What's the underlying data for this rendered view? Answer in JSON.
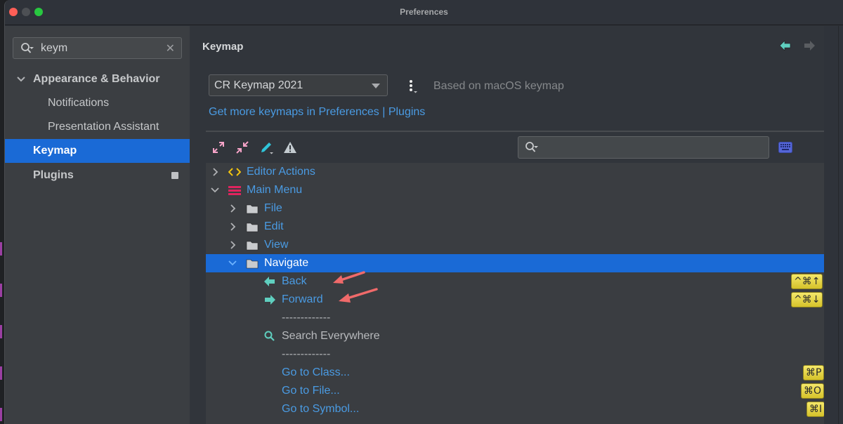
{
  "window": {
    "title": "Preferences"
  },
  "sidebar": {
    "search": {
      "value": "keym",
      "placeholder": ""
    },
    "items": [
      {
        "label": "Appearance & Behavior",
        "expanded": true,
        "level": 0
      },
      {
        "label": "Notifications",
        "level": 1
      },
      {
        "label": "Presentation Assistant",
        "level": 1
      },
      {
        "label": "Keymap",
        "level": 0,
        "selected": true
      },
      {
        "label": "Plugins",
        "level": 0,
        "badge": "plugin-badge-icon"
      }
    ]
  },
  "main": {
    "title": "Keymap",
    "keymap_select": {
      "value": "CR Keymap 2021"
    },
    "based_on": "Based on macOS keymap",
    "get_more_link": "Get more keymaps in Preferences | Plugins",
    "toolbar": {
      "icons": [
        "expand-all-icon",
        "collapse-all-icon",
        "edit-icon",
        "warning-icon"
      ],
      "filter_placeholder": "",
      "find_by_shortcut_icon": "keyboard-icon"
    },
    "tree": [
      {
        "label": "Editor Actions",
        "icon": "code-brackets-icon",
        "expanded": false,
        "level": 0
      },
      {
        "label": "Main Menu",
        "icon": "menu-icon",
        "expanded": true,
        "level": 0
      },
      {
        "label": "File",
        "icon": "folder-icon",
        "expanded": false,
        "level": 1
      },
      {
        "label": "Edit",
        "icon": "folder-icon",
        "expanded": false,
        "level": 1
      },
      {
        "label": "View",
        "icon": "folder-icon",
        "expanded": false,
        "level": 1
      },
      {
        "label": "Navigate",
        "icon": "folder-icon",
        "expanded": true,
        "level": 1,
        "selected": true
      },
      {
        "label": "Back",
        "icon": "back-arrow-icon",
        "level": 2,
        "shortcut": "^⌘↑"
      },
      {
        "label": "Forward",
        "icon": "forward-arrow-icon",
        "level": 2,
        "shortcut": "^⌘↓"
      },
      {
        "label": "-------------",
        "level": 2,
        "separator": true
      },
      {
        "label": "Search Everywhere",
        "icon": "search-icon",
        "level": 2,
        "plain": true
      },
      {
        "label": "-------------",
        "level": 2,
        "separator": true
      },
      {
        "label": "Go to Class...",
        "level": 2,
        "shortcut": "⌘P"
      },
      {
        "label": "Go to File...",
        "level": 2,
        "shortcut": "⌘O"
      },
      {
        "label": "Go to Symbol...",
        "level": 2,
        "shortcut": "⌘I"
      }
    ]
  },
  "colors": {
    "accent": "#1a6ad6",
    "link": "#4a9be3",
    "shortcut_bg": "#e8d84a",
    "annotation_arrow": "#f06a6a",
    "nav_arrow": "#5fcfbf"
  }
}
